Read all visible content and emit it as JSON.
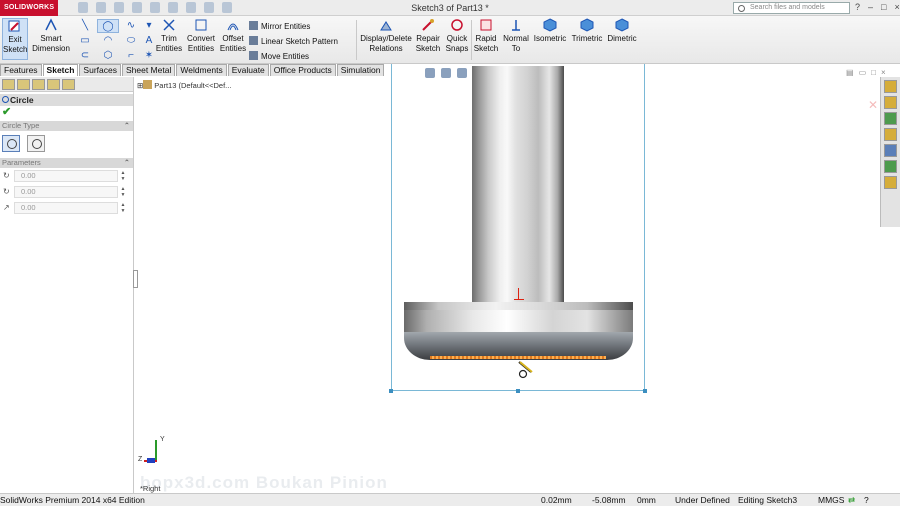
{
  "app": {
    "brand": "SOLIDWORKS",
    "document_title": "Sketch3 of Part13 *",
    "search_placeholder": "Search files and models",
    "window_controls": [
      "?",
      "–",
      "□",
      "×"
    ]
  },
  "ribbon": {
    "exit_sketch": "Exit Sketch",
    "smart_dimension": "Smart Dimension",
    "trim_entities": "Trim Entities",
    "convert_entities": "Convert Entities",
    "offset_entities": "Offset Entities",
    "mirror_entities": "Mirror Entities",
    "linear_sketch_pattern": "Linear Sketch Pattern",
    "move_entities": "Move Entities",
    "display_delete_relations": "Display/Delete Relations",
    "repair_sketch": "Repair Sketch",
    "quick_snaps": "Quick Snaps",
    "rapid_sketch": "Rapid Sketch",
    "normal_to": "Normal To",
    "isometric": "Isometric",
    "trimetric": "Trimetric",
    "dimetric": "Dimetric"
  },
  "tabs": [
    "Features",
    "Sketch",
    "Surfaces",
    "Sheet Metal",
    "Weldments",
    "Evaluate",
    "Office Products",
    "Simulation"
  ],
  "active_tab": "Sketch",
  "property_manager": {
    "title": "Circle",
    "circle_type_label": "Circle Type",
    "parameters_label": "Parameters",
    "params": [
      "0.00",
      "0.00",
      "0.00"
    ]
  },
  "feature_tree": {
    "root": "Part13  (Default<<Def..."
  },
  "viewport": {
    "view_name": "*Right",
    "triad_z": "Z",
    "triad_y": "Y",
    "watermark": "bopx3d.com  Boukan Pinion"
  },
  "statusbar": {
    "edition": "SolidWorks Premium 2014 x64 Edition",
    "x": "0.02mm",
    "y": "-5.08mm",
    "z": "0mm",
    "state": "Under Defined",
    "editing": "Editing Sketch3",
    "units": "MMGS"
  },
  "colors": {
    "brand_red": "#c8102e",
    "accent_blue": "#1d55b4",
    "edge_orange": "#e07a1f"
  }
}
